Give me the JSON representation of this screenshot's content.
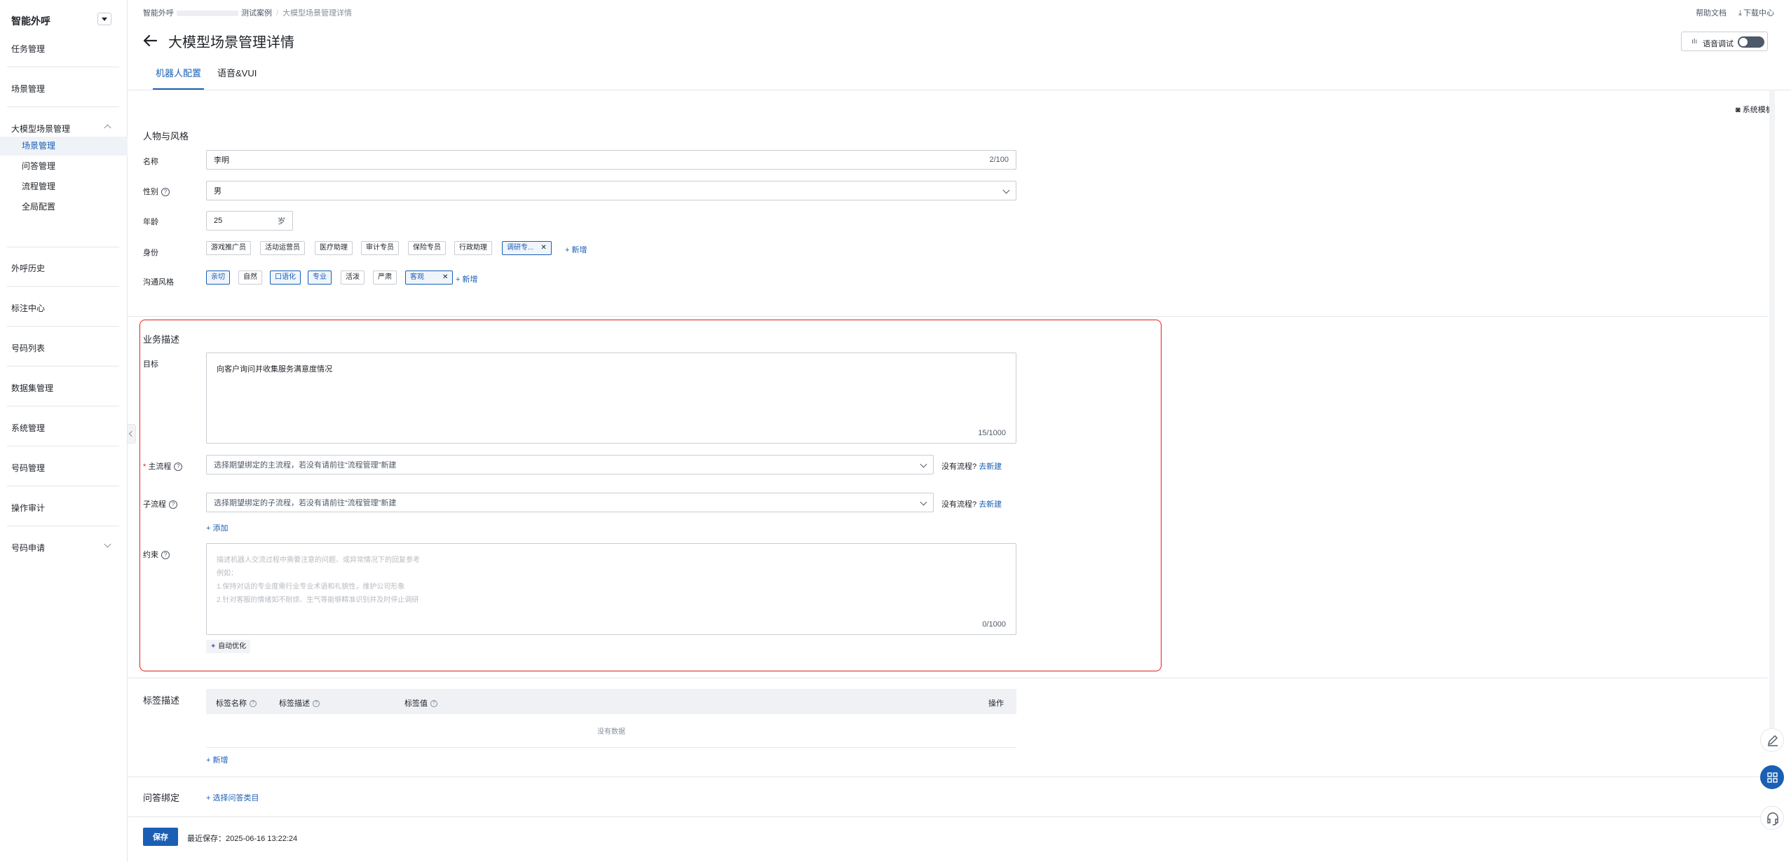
{
  "sidebar": {
    "title": "智能外呼",
    "items": {
      "task": "任务管理",
      "scene": "场景管理",
      "llm_scene": "大模型场景管理",
      "sub_scene": "场景管理",
      "sub_qa": "问答管理",
      "sub_flow": "流程管理",
      "sub_global": "全局配置",
      "history": "外呼历史",
      "annotation": "标注中心",
      "number_list": "号码列表",
      "dataset": "数据集管理",
      "system": "系统管理",
      "number_mgmt": "号码管理",
      "audit": "操作审计",
      "number_apply": "号码申请"
    }
  },
  "breadcrumb": {
    "root": "智能外呼",
    "case": "测试案例",
    "current": "大模型场景管理详情"
  },
  "top_right": {
    "help": "帮助文档",
    "download": "下载中心"
  },
  "page_title": "大模型场景管理详情",
  "voice_debug": {
    "label": "语音调试",
    "icon": "equalizer-icon",
    "enabled": false
  },
  "tabs": [
    {
      "label": "机器人配置",
      "active": true
    },
    {
      "label": "语音&VUI",
      "active": false
    }
  ],
  "system_template": "系统模板",
  "persona": {
    "section_title": "人物与风格",
    "name_label": "名称",
    "name_value": "李明",
    "name_count": "2/100",
    "gender_label": "性别",
    "gender_value": "男",
    "age_label": "年龄",
    "age_value": "25",
    "age_unit": "岁",
    "identity_label": "身份",
    "identity_tags": [
      "游戏推广员",
      "活动运营员",
      "医疗助理",
      "审计专员",
      "保险专员",
      "行政助理",
      "调研专..."
    ],
    "identity_add": "+ 新增",
    "style_label": "沟通风格",
    "style_tags": [
      "亲切",
      "自然",
      "口语化",
      "专业",
      "活泼",
      "严肃",
      "客观"
    ],
    "style_add": "+ 新增"
  },
  "business": {
    "section_title": "业务描述",
    "goal_label": "目标",
    "goal_value": "向客户询问并收集服务满意度情况",
    "goal_count": "15/1000",
    "main_flow_label": "主流程",
    "main_flow_placeholder": "选择期望绑定的主流程，若没有请前往“流程管理”新建",
    "sub_flow_label": "子流程",
    "sub_flow_placeholder": "选择期望绑定的子流程，若没有请前往“流程管理”新建",
    "no_flow_text": "没有流程?",
    "no_flow_link": "去新建",
    "add_label": "+ 添加",
    "constraint_label": "约束",
    "constraint_placeholder_lines": [
      "描述机器人交流过程中需要注意的问题、或异常情况下的回复参考",
      "例如：",
      "1.保持对话的专业度需行业专业术语和礼貌性，维护公司形象",
      "2.针对客服的情绪如不耐烦、生气等能够精准识别并及时停止调研"
    ],
    "constraint_count": "0/1000",
    "auto_optimize": "自动优化"
  },
  "label_desc": {
    "section_title": "标签描述",
    "columns": [
      "标签名称",
      "标签描述",
      "标签值",
      "操作"
    ],
    "empty_text": "没有数据",
    "add_label": "+ 新增"
  },
  "qa_binding": {
    "section_title": "问答绑定",
    "select_label": "+ 选择问答类目"
  },
  "footer": {
    "save_label": "保存",
    "last_saved": "最近保存：2025-06-16 13:22:24"
  },
  "floating": [
    "edit-icon",
    "grid-icon",
    "headset-icon"
  ],
  "colors": {
    "primary": "#1a5fb4",
    "highlight_border": "#e0201b"
  }
}
